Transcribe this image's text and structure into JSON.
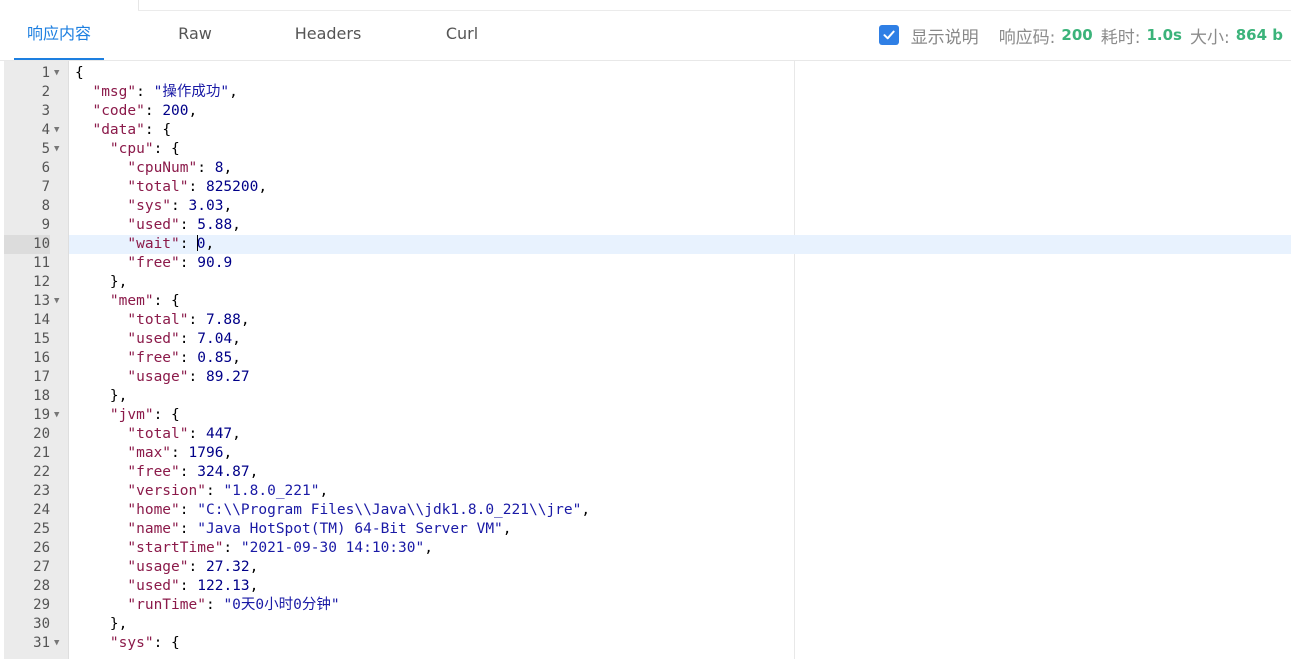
{
  "tabs": [
    {
      "label": "响应内容",
      "active": true
    },
    {
      "label": "Raw",
      "active": false
    },
    {
      "label": "Headers",
      "active": false
    },
    {
      "label": "Curl",
      "active": false
    }
  ],
  "meta": {
    "show_desc_label": "显示说明",
    "show_desc_checked": true,
    "status_label": "响应码:",
    "status_value": "200",
    "time_label": "耗时:",
    "time_value": "1.0s",
    "size_label": "大小:",
    "size_value": "864 b"
  },
  "colors": {
    "accent": "#1d7fe0",
    "success": "#3bb37a"
  },
  "editor": {
    "active_line": 10,
    "lines": [
      {
        "n": "1",
        "fold": true,
        "indent": 0,
        "parts": [
          [
            "p",
            "{"
          ]
        ]
      },
      {
        "n": "2",
        "fold": false,
        "indent": 1,
        "parts": [
          [
            "k",
            "\"msg\""
          ],
          [
            "p",
            ": "
          ],
          [
            "s",
            "\"操作成功\""
          ],
          [
            "p",
            ","
          ]
        ]
      },
      {
        "n": "3",
        "fold": false,
        "indent": 1,
        "parts": [
          [
            "k",
            "\"code\""
          ],
          [
            "p",
            ": "
          ],
          [
            "n",
            "200"
          ],
          [
            "p",
            ","
          ]
        ]
      },
      {
        "n": "4",
        "fold": true,
        "indent": 1,
        "parts": [
          [
            "k",
            "\"data\""
          ],
          [
            "p",
            ": {"
          ]
        ]
      },
      {
        "n": "5",
        "fold": true,
        "indent": 2,
        "parts": [
          [
            "k",
            "\"cpu\""
          ],
          [
            "p",
            ": {"
          ]
        ]
      },
      {
        "n": "6",
        "fold": false,
        "indent": 3,
        "parts": [
          [
            "k",
            "\"cpuNum\""
          ],
          [
            "p",
            ": "
          ],
          [
            "n",
            "8"
          ],
          [
            "p",
            ","
          ]
        ]
      },
      {
        "n": "7",
        "fold": false,
        "indent": 3,
        "parts": [
          [
            "k",
            "\"total\""
          ],
          [
            "p",
            ": "
          ],
          [
            "n",
            "825200"
          ],
          [
            "p",
            ","
          ]
        ]
      },
      {
        "n": "8",
        "fold": false,
        "indent": 3,
        "parts": [
          [
            "k",
            "\"sys\""
          ],
          [
            "p",
            ": "
          ],
          [
            "n",
            "3.03"
          ],
          [
            "p",
            ","
          ]
        ]
      },
      {
        "n": "9",
        "fold": false,
        "indent": 3,
        "parts": [
          [
            "k",
            "\"used\""
          ],
          [
            "p",
            ": "
          ],
          [
            "n",
            "5.88"
          ],
          [
            "p",
            ","
          ]
        ]
      },
      {
        "n": "10",
        "fold": false,
        "indent": 3,
        "parts": [
          [
            "k",
            "\"wait\""
          ],
          [
            "p",
            ": "
          ],
          [
            "c",
            ""
          ],
          [
            "n",
            "0"
          ],
          [
            "p",
            ","
          ]
        ]
      },
      {
        "n": "11",
        "fold": false,
        "indent": 3,
        "parts": [
          [
            "k",
            "\"free\""
          ],
          [
            "p",
            ": "
          ],
          [
            "n",
            "90.9"
          ]
        ]
      },
      {
        "n": "12",
        "fold": false,
        "indent": 2,
        "parts": [
          [
            "p",
            "},"
          ]
        ]
      },
      {
        "n": "13",
        "fold": true,
        "indent": 2,
        "parts": [
          [
            "k",
            "\"mem\""
          ],
          [
            "p",
            ": {"
          ]
        ]
      },
      {
        "n": "14",
        "fold": false,
        "indent": 3,
        "parts": [
          [
            "k",
            "\"total\""
          ],
          [
            "p",
            ": "
          ],
          [
            "n",
            "7.88"
          ],
          [
            "p",
            ","
          ]
        ]
      },
      {
        "n": "15",
        "fold": false,
        "indent": 3,
        "parts": [
          [
            "k",
            "\"used\""
          ],
          [
            "p",
            ": "
          ],
          [
            "n",
            "7.04"
          ],
          [
            "p",
            ","
          ]
        ]
      },
      {
        "n": "16",
        "fold": false,
        "indent": 3,
        "parts": [
          [
            "k",
            "\"free\""
          ],
          [
            "p",
            ": "
          ],
          [
            "n",
            "0.85"
          ],
          [
            "p",
            ","
          ]
        ]
      },
      {
        "n": "17",
        "fold": false,
        "indent": 3,
        "parts": [
          [
            "k",
            "\"usage\""
          ],
          [
            "p",
            ": "
          ],
          [
            "n",
            "89.27"
          ]
        ]
      },
      {
        "n": "18",
        "fold": false,
        "indent": 2,
        "parts": [
          [
            "p",
            "},"
          ]
        ]
      },
      {
        "n": "19",
        "fold": true,
        "indent": 2,
        "parts": [
          [
            "k",
            "\"jvm\""
          ],
          [
            "p",
            ": {"
          ]
        ]
      },
      {
        "n": "20",
        "fold": false,
        "indent": 3,
        "parts": [
          [
            "k",
            "\"total\""
          ],
          [
            "p",
            ": "
          ],
          [
            "n",
            "447"
          ],
          [
            "p",
            ","
          ]
        ]
      },
      {
        "n": "21",
        "fold": false,
        "indent": 3,
        "parts": [
          [
            "k",
            "\"max\""
          ],
          [
            "p",
            ": "
          ],
          [
            "n",
            "1796"
          ],
          [
            "p",
            ","
          ]
        ]
      },
      {
        "n": "22",
        "fold": false,
        "indent": 3,
        "parts": [
          [
            "k",
            "\"free\""
          ],
          [
            "p",
            ": "
          ],
          [
            "n",
            "324.87"
          ],
          [
            "p",
            ","
          ]
        ]
      },
      {
        "n": "23",
        "fold": false,
        "indent": 3,
        "parts": [
          [
            "k",
            "\"version\""
          ],
          [
            "p",
            ": "
          ],
          [
            "s",
            "\"1.8.0_221\""
          ],
          [
            "p",
            ","
          ]
        ]
      },
      {
        "n": "24",
        "fold": false,
        "indent": 3,
        "parts": [
          [
            "k",
            "\"home\""
          ],
          [
            "p",
            ": "
          ],
          [
            "s",
            "\"C:\\\\Program Files\\\\Java\\\\jdk1.8.0_221\\\\jre\""
          ],
          [
            "p",
            ","
          ]
        ]
      },
      {
        "n": "25",
        "fold": false,
        "indent": 3,
        "parts": [
          [
            "k",
            "\"name\""
          ],
          [
            "p",
            ": "
          ],
          [
            "s",
            "\"Java HotSpot(TM) 64-Bit Server VM\""
          ],
          [
            "p",
            ","
          ]
        ]
      },
      {
        "n": "26",
        "fold": false,
        "indent": 3,
        "parts": [
          [
            "k",
            "\"startTime\""
          ],
          [
            "p",
            ": "
          ],
          [
            "s",
            "\"2021-09-30 14:10:30\""
          ],
          [
            "p",
            ","
          ]
        ]
      },
      {
        "n": "27",
        "fold": false,
        "indent": 3,
        "parts": [
          [
            "k",
            "\"usage\""
          ],
          [
            "p",
            ": "
          ],
          [
            "n",
            "27.32"
          ],
          [
            "p",
            ","
          ]
        ]
      },
      {
        "n": "28",
        "fold": false,
        "indent": 3,
        "parts": [
          [
            "k",
            "\"used\""
          ],
          [
            "p",
            ": "
          ],
          [
            "n",
            "122.13"
          ],
          [
            "p",
            ","
          ]
        ]
      },
      {
        "n": "29",
        "fold": false,
        "indent": 3,
        "parts": [
          [
            "k",
            "\"runTime\""
          ],
          [
            "p",
            ": "
          ],
          [
            "s",
            "\"0天0小时0分钟\""
          ]
        ]
      },
      {
        "n": "30",
        "fold": false,
        "indent": 2,
        "parts": [
          [
            "p",
            "},"
          ]
        ]
      },
      {
        "n": "31",
        "fold": true,
        "indent": 2,
        "parts": [
          [
            "k",
            "\"sys\""
          ],
          [
            "p",
            ": {"
          ]
        ]
      }
    ]
  }
}
